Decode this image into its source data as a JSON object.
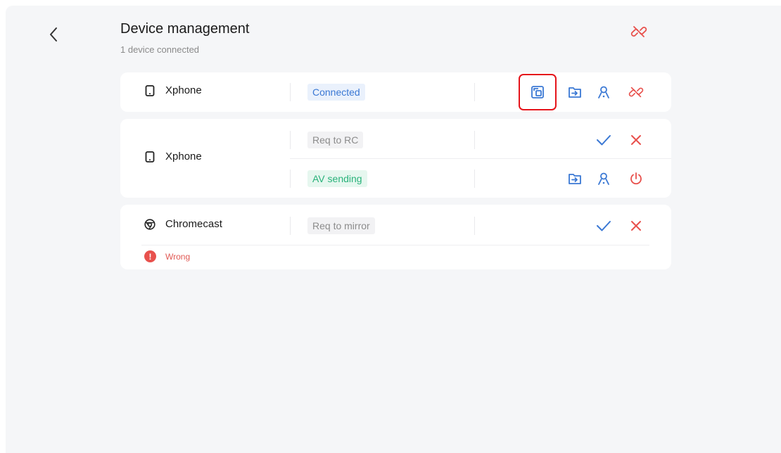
{
  "header": {
    "title": "Device management",
    "subtitle": "1 device connected"
  },
  "devices": [
    {
      "name": "Xphone",
      "icon": "phone-icon",
      "status": "Connected",
      "actions": [
        "screen-mirror-icon",
        "file-transfer-icon",
        "user-control-icon",
        "disconnect-icon"
      ]
    },
    {
      "name": "Xphone",
      "icon": "phone-icon",
      "requests": [
        {
          "status": "Req to RC",
          "actions": [
            "accept-icon",
            "reject-icon"
          ]
        },
        {
          "status": "AV sending",
          "actions": [
            "file-transfer-icon",
            "user-control-icon",
            "power-icon"
          ]
        }
      ]
    },
    {
      "name": "Chromecast",
      "icon": "chromecast-icon",
      "status": "Req to mirror",
      "actions": [
        "accept-icon",
        "reject-icon"
      ],
      "error": "Wrong"
    }
  ],
  "colors": {
    "accent_blue": "#3a78d4",
    "danger_red": "#e8514d",
    "success_green": "#29b27a",
    "highlight_red": "#e5141b"
  }
}
